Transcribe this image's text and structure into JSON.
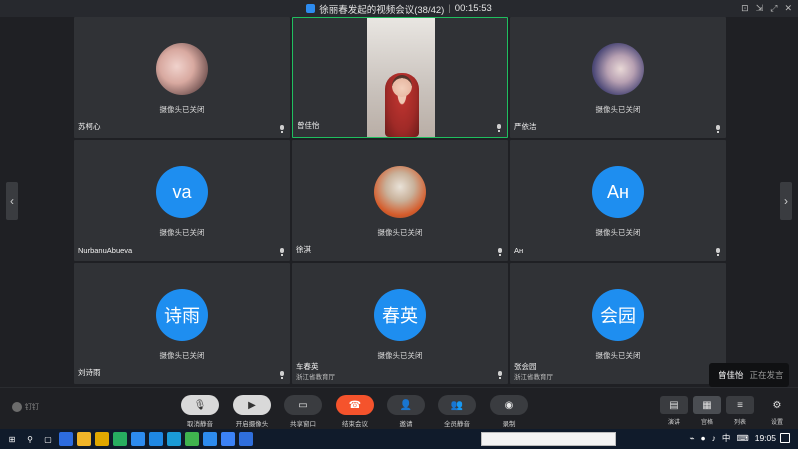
{
  "window": {
    "title": "徐丽春发起的视频会议(38/42)",
    "timer": "00:15:53",
    "controls": [
      "⊡",
      "⇲",
      "⤢",
      "✕"
    ]
  },
  "tiles": [
    {
      "name": "苏柯心",
      "status": "摄像头已关闭",
      "avatar_type": "photo1"
    },
    {
      "name": "曾佳怡",
      "status": "",
      "avatar_type": "video",
      "active": true
    },
    {
      "name": "严依洁",
      "status": "摄像头已关闭",
      "avatar_type": "photo2"
    },
    {
      "name": "NurbanuAbueva",
      "status": "摄像头已关闭",
      "avatar_type": "initials",
      "initials": "va"
    },
    {
      "name": "徐淇",
      "status": "摄像头已关闭",
      "avatar_type": "photo3"
    },
    {
      "name": "Ан",
      "status": "摄像头已关闭",
      "avatar_type": "initials",
      "initials": "Ан"
    },
    {
      "name": "刘诗雨",
      "status": "摄像头已关闭",
      "avatar_type": "initials",
      "initials": "诗雨"
    },
    {
      "name": "车春英",
      "sub": "浙江省教育厅",
      "status": "摄像头已关闭",
      "avatar_type": "initials",
      "initials": "春英"
    },
    {
      "name": "张会园",
      "sub": "浙江省教育厅",
      "status": "摄像头已关闭",
      "avatar_type": "initials",
      "initials": "会园"
    }
  ],
  "speaking": {
    "name": "曾佳怡",
    "status": "正在发言"
  },
  "toolbar": {
    "logo_text": "钉钉",
    "buttons": [
      {
        "label": "取消静音",
        "icon": "mic-muted-icon",
        "glyph": "🎙"
      },
      {
        "label": "开启摄像头",
        "icon": "camera-icon",
        "glyph": "▶"
      },
      {
        "label": "共享窗口",
        "icon": "screen-share-icon",
        "glyph": "▭"
      },
      {
        "label": "结束会议",
        "icon": "hangup-icon",
        "glyph": "☎"
      },
      {
        "label": "邀请",
        "icon": "invite-icon",
        "glyph": "👤"
      },
      {
        "label": "全员静音",
        "icon": "mute-all-icon",
        "glyph": "👥"
      },
      {
        "label": "录制",
        "icon": "record-icon",
        "glyph": "◉"
      }
    ],
    "views": [
      {
        "label": "演讲",
        "icon": "speaker-view-icon",
        "glyph": "▤"
      },
      {
        "label": "宫格",
        "icon": "grid-view-icon",
        "glyph": "▦"
      },
      {
        "label": "列表",
        "icon": "list-view-icon",
        "glyph": "≡"
      }
    ],
    "settings_label": "设置"
  },
  "taskbar": {
    "tray_lang": "中",
    "clock": "19:05",
    "apps": [
      "#2d6cdf",
      "#f0b429",
      "#e0a800",
      "#27ae60",
      "#2d8cf0",
      "#1e88e5",
      "#1a9bd7",
      "#3fb34f",
      "#2d8cf0",
      "#3b82f6",
      "#2f6fdd"
    ]
  },
  "colors": {
    "accent_blue": "#1e8ef0",
    "active_border": "#1fbf5f",
    "end_red": "#f5532c"
  }
}
